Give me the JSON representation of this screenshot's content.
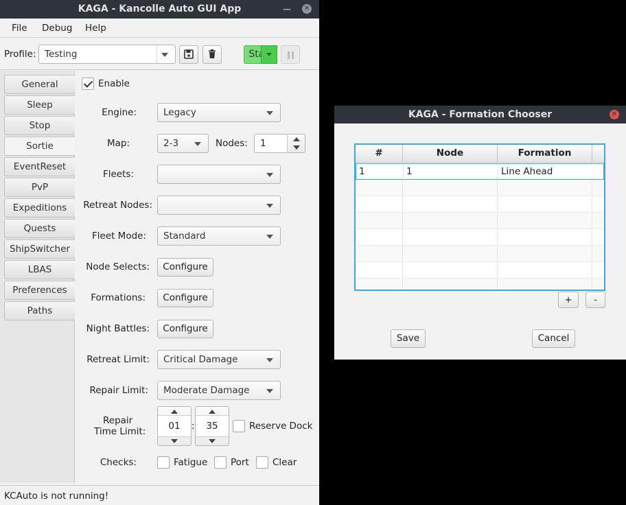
{
  "main_window": {
    "title": "KAGA - Kancolle Auto GUI App",
    "menu": [
      "File",
      "Debug",
      "Help"
    ],
    "profile_label": "Profile:",
    "profile_value": "Testing",
    "start_label": "Start"
  },
  "sidebar": {
    "tabs": [
      "General",
      "Sleep",
      "Stop",
      "Sortie",
      "EventReset",
      "PvP",
      "Expeditions",
      "Quests",
      "ShipSwitcher",
      "LBAS",
      "Preferences",
      "Paths"
    ],
    "active_tab": "Sortie"
  },
  "sortie": {
    "enable_label": "Enable",
    "enable_checked": true,
    "engine_label": "Engine:",
    "engine_value": "Legacy",
    "map_label": "Map:",
    "map_value": "2-3",
    "nodes_label": "Nodes:",
    "nodes_value": "1",
    "fleets_label": "Fleets:",
    "fleets_value": "",
    "retreat_nodes_label": "Retreat Nodes:",
    "retreat_nodes_value": "",
    "fleet_mode_label": "Fleet Mode:",
    "fleet_mode_value": "Standard",
    "node_selects_label": "Node Selects:",
    "formations_label": "Formations:",
    "night_battles_label": "Night Battles:",
    "configure_label": "Configure",
    "retreat_limit_label": "Retreat Limit:",
    "retreat_limit_value": "Critical Damage",
    "repair_limit_label": "Repair Limit:",
    "repair_limit_value": "Moderate Damage",
    "repair_time_label_1": "Repair",
    "repair_time_label_2": "Time Limit:",
    "repair_hours": "01",
    "repair_minutes": "35",
    "time_separator": ":",
    "reserve_dock_label": "Reserve Dock",
    "checks_label": "Checks:",
    "check_fatigue": "Fatigue",
    "check_port": "Port",
    "check_clear": "Clear"
  },
  "status": "KCAuto is not running!",
  "dialog": {
    "title": "KAGA - Formation Chooser",
    "columns": [
      "#",
      "Node",
      "Formation"
    ],
    "rows": [
      {
        "num": "1",
        "node": "1",
        "formation": "Line Ahead"
      }
    ],
    "add_label": "+",
    "remove_label": "-",
    "save_label": "Save",
    "cancel_label": "Cancel"
  },
  "colors": {
    "start_green": "#77dd77",
    "titlebar": "#2f343a",
    "table_focus": "#39a9e0",
    "dialog_close": "#e25252"
  }
}
